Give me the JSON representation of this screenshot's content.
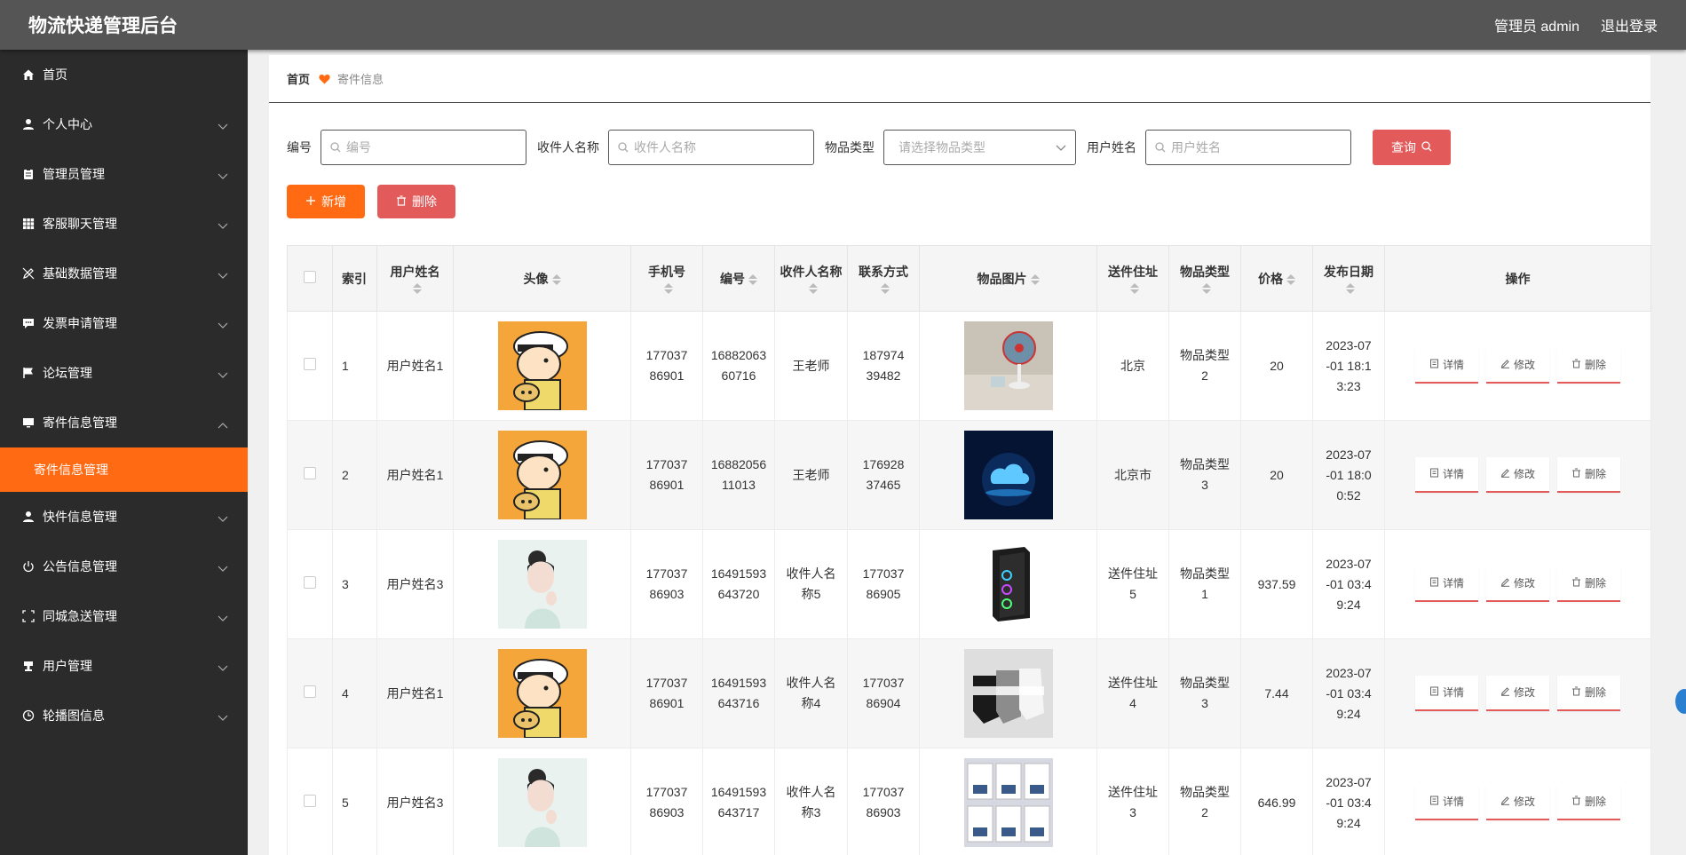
{
  "header": {
    "title": "物流快递管理后台",
    "admin_label": "管理员 admin",
    "logout": "退出登录"
  },
  "sidebar": {
    "items": [
      {
        "label": "首页",
        "icon": "home-icon"
      },
      {
        "label": "个人中心",
        "icon": "user-icon"
      },
      {
        "label": "管理员管理",
        "icon": "clipboard-icon"
      },
      {
        "label": "客服聊天管理",
        "icon": "grid-icon"
      },
      {
        "label": "基础数据管理",
        "icon": "edit-off-icon"
      },
      {
        "label": "发票申请管理",
        "icon": "chat-icon"
      },
      {
        "label": "论坛管理",
        "icon": "flag-icon"
      },
      {
        "label": "寄件信息管理",
        "icon": "monitor-icon"
      },
      {
        "label": "快件信息管理",
        "icon": "user-icon"
      },
      {
        "label": "公告信息管理",
        "icon": "power-icon"
      },
      {
        "label": "同城急送管理",
        "icon": "fullscreen-icon"
      },
      {
        "label": "用户管理",
        "icon": "stamp-icon"
      },
      {
        "label": "轮播图信息",
        "icon": "clock-icon"
      }
    ],
    "active_sub": "寄件信息管理"
  },
  "breadcrumb": {
    "home": "首页",
    "current": "寄件信息"
  },
  "search": {
    "f1_label": "编号",
    "f1_placeholder": "编号",
    "f2_label": "收件人名称",
    "f2_placeholder": "收件人名称",
    "f3_label": "物品类型",
    "f3_placeholder": "请选择物品类型",
    "f4_label": "用户姓名",
    "f4_placeholder": "用户姓名",
    "query": "查询"
  },
  "actions": {
    "add": "新增",
    "delete": "删除"
  },
  "table": {
    "headers": {
      "index": "索引",
      "username": "用户姓名",
      "avatar": "头像",
      "phone": "手机号",
      "code": "编号",
      "receiver": "收件人名称",
      "contact": "联系方式",
      "image": "物品图片",
      "address": "送件住址",
      "type": "物品类型",
      "price": "价格",
      "date": "发布日期",
      "ops": "操作"
    },
    "op_labels": {
      "detail": "详情",
      "edit": "修改",
      "delete": "删除"
    },
    "rows": [
      {
        "index": "1",
        "username": "用户姓名1",
        "avatar": "cartoon",
        "phone": "17703786901",
        "code": "1688206360716",
        "receiver": "王老师",
        "contact": "18797439482",
        "image": "fan",
        "address": "北京",
        "type": "物品类型2",
        "price": "20",
        "date": "2023-07-01 18:13:23"
      },
      {
        "index": "2",
        "username": "用户姓名1",
        "avatar": "cartoon",
        "phone": "17703786901",
        "code": "1688205611013",
        "receiver": "王老师",
        "contact": "17692837465",
        "image": "cloud",
        "address": "北京市",
        "type": "物品类型3",
        "price": "20",
        "date": "2023-07-01 18:00:52"
      },
      {
        "index": "3",
        "username": "用户姓名3",
        "avatar": "woman",
        "phone": "17703786903",
        "code": "16491593643720",
        "receiver": "收件人名称5",
        "contact": "17703786905",
        "image": "pc",
        "address": "送件住址5",
        "type": "物品类型1",
        "price": "937.59",
        "date": "2023-07-01 03:49:24"
      },
      {
        "index": "4",
        "username": "用户姓名1",
        "avatar": "cartoon",
        "phone": "17703786901",
        "code": "16491593643716",
        "receiver": "收件人名称4",
        "contact": "17703786904",
        "image": "socks",
        "address": "送件住址4",
        "type": "物品类型3",
        "price": "7.44",
        "date": "2023-07-01 03:49:24"
      },
      {
        "index": "5",
        "username": "用户姓名3",
        "avatar": "woman",
        "phone": "17703786903",
        "code": "16491593643717",
        "receiver": "收件人名称3",
        "contact": "17703786903",
        "image": "products",
        "address": "送件住址3",
        "type": "物品类型2",
        "price": "646.99",
        "date": "2023-07-01 03:49:24"
      }
    ]
  }
}
